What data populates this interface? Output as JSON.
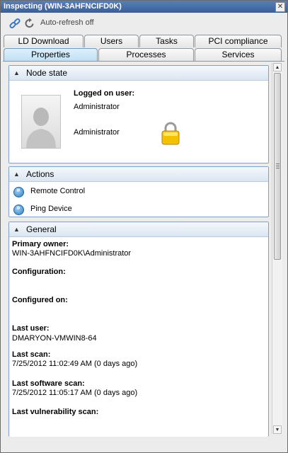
{
  "window": {
    "title": "Inspecting (WIN-3AHFNCIFD0K)",
    "close_glyph": "✕"
  },
  "toolbar": {
    "auto_refresh_label": "Auto-refresh off"
  },
  "tabs_row1": [
    "LD Download",
    "Users",
    "Tasks",
    "PCI compliance"
  ],
  "tabs_row2": [
    "Properties",
    "Processes",
    "Services"
  ],
  "active_tab": "Properties",
  "node_state": {
    "title": "Node state",
    "logged_on_user_label": "Logged on user:",
    "logged_on_user_value": "Administrator",
    "user_display_name": "Administrator",
    "icons": [
      "user-avatar-icon",
      "lock-icon"
    ]
  },
  "actions": {
    "title": "Actions",
    "items": [
      "Remote Control",
      "Ping Device"
    ]
  },
  "general": {
    "title": "General",
    "fields": [
      {
        "label": "Primary owner:",
        "value": "WIN-3AHFNCIFD0K\\Administrator"
      },
      {
        "label": "Configuration:",
        "value": ""
      },
      {
        "label": "Configured on:",
        "value": ""
      },
      {
        "label": "Last user:",
        "value": "DMARYON-VMWIN8-64"
      },
      {
        "label": "Last scan:",
        "value": "7/25/2012 11:02:49 AM (0 days ago)"
      },
      {
        "label": "Last software scan:",
        "value": "7/25/2012 11:05:17 AM (0 days ago)"
      },
      {
        "label": "Last vulnerability scan:",
        "value": ""
      }
    ]
  },
  "colors": {
    "title_bar": "#3a5f98",
    "panel_border": "#7da2c6",
    "active_tab": "#bfe0f6"
  }
}
